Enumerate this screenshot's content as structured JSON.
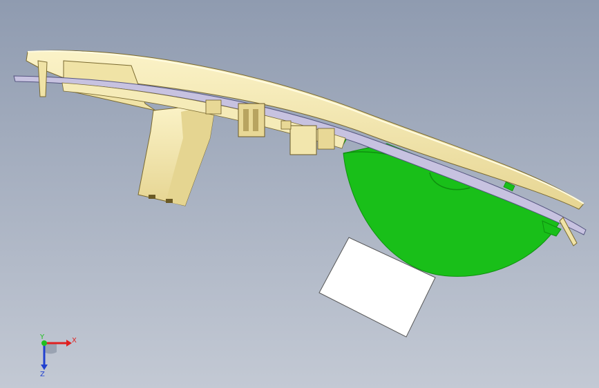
{
  "viewport": {
    "background_top": "#8f9bb0",
    "background_bottom": "#c3c9d4"
  },
  "model": {
    "housing_color": "#f2e7ae",
    "housing_shadow": "#d9c98a",
    "lens_color": "#c7c2e0",
    "reflector_color": "#19bf19",
    "reflector_edge": "#0f8f0f",
    "plate_color": "#ffffff"
  },
  "triad": {
    "x_label": "X",
    "y_label": "Y",
    "z_label": "Z",
    "x_color": "#e02020",
    "y_color": "#20c020",
    "z_color": "#2040d0"
  }
}
